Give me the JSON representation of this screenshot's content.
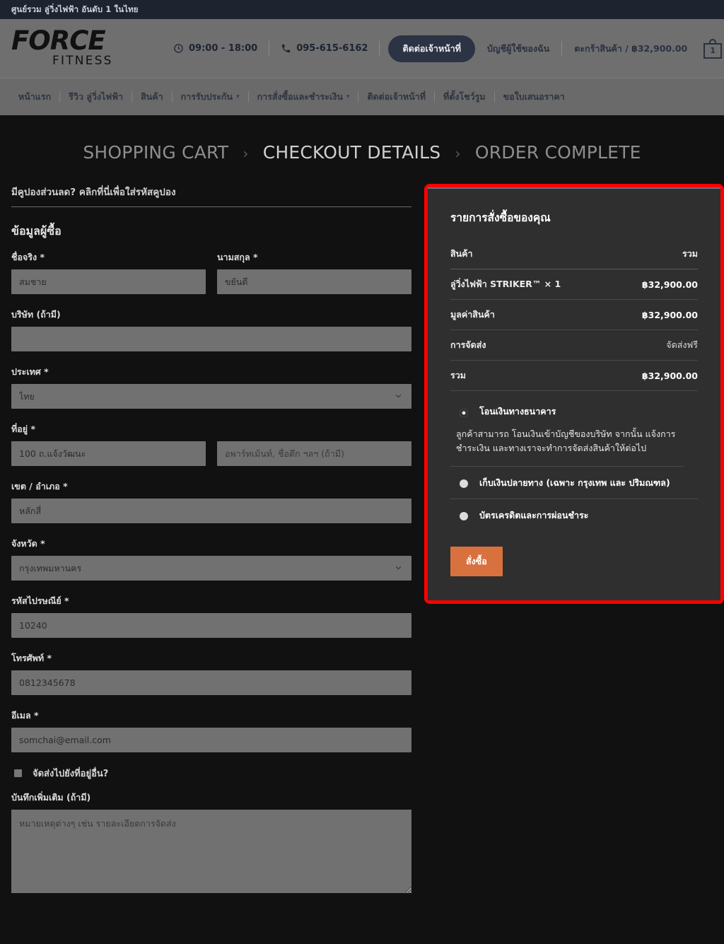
{
  "topbar": {
    "tagline": "ศูนย์รวม ลู่วิ่งไฟฟ้า อันดับ 1 ในไทย"
  },
  "header": {
    "logo_mark": "FORCE",
    "logo_sub": "FITNESS",
    "hours": "09:00 - 18:00",
    "phone": "095-615-6162",
    "contact_button": "ติดต่อเจ้าหน้าที่",
    "account_link": "บัญชีผู้ใช้ของฉัน",
    "cart_link": "ตะกร้าสินค้า / ฿32,900.00",
    "cart_count": "1"
  },
  "nav": {
    "items": [
      {
        "label": "หน้าแรก",
        "has_caret": false
      },
      {
        "label": "รีวิว ลู่วิ่งไฟฟ้า",
        "has_caret": false
      },
      {
        "label": "สินค้า",
        "has_caret": false
      },
      {
        "label": "การรับประกัน",
        "has_caret": true
      },
      {
        "label": "การสั่งซื้อและชำระเงิน",
        "has_caret": true
      },
      {
        "label": "ติดต่อเจ้าหน้าที่",
        "has_caret": false
      },
      {
        "label": "ที่ตั้งโชว์รูม",
        "has_caret": false
      },
      {
        "label": "ขอใบเสนอราคา",
        "has_caret": false
      }
    ]
  },
  "steps": {
    "cart": "SHOPPING CART",
    "details": "CHECKOUT DETAILS",
    "complete": "ORDER COMPLETE",
    "separator": "›"
  },
  "checkout": {
    "coupon_text": "มีคูปองส่วนลด? คลิกที่นี่เพื่อใส่รหัสคูปอง",
    "billing_title": "ข้อมูลผู้ซื้อ",
    "first_name": {
      "label": "ชื่อจริง",
      "required": "*",
      "value": "สมชาย"
    },
    "last_name": {
      "label": "นามสกุล",
      "required": "*",
      "value": "ขยันดี"
    },
    "company": {
      "label": "บริษัท (ถ้ามี)",
      "value": ""
    },
    "country": {
      "label": "ประเทศ",
      "required": "*",
      "value": "ไทย"
    },
    "address": {
      "label": "ที่อยู่",
      "required": "*",
      "value": "100 ถ.แจ้งวัฒนะ"
    },
    "address2": {
      "placeholder": "อพาร์ทเม้นท์, ชื่อตึก ฯลฯ (ถ้ามี)",
      "value": ""
    },
    "district": {
      "label": "เขต / อำเภอ",
      "required": "*",
      "value": "หลักสี่"
    },
    "province": {
      "label": "จังหวัด",
      "required": "*",
      "value": "กรุงเทพมหานคร"
    },
    "postcode": {
      "label": "รหัสไปรษณีย์",
      "required": "*",
      "value": "10240"
    },
    "phone": {
      "label": "โทรศัพท์",
      "required": "*",
      "value": "0812345678"
    },
    "email": {
      "label": "อีเมล",
      "required": "*",
      "value": "somchai@email.com"
    },
    "ship_other": {
      "label": "จัดส่งไปยังที่อยู่อื่น?",
      "checked": false
    },
    "notes": {
      "label": "บันทึกเพิ่มเติม (ถ้ามี)",
      "placeholder": "หมายเหตุต่างๆ เช่น รายละเอียดการจัดส่ง",
      "value": ""
    }
  },
  "order_summary": {
    "title": "รายการสั่งซื้อของคุณ",
    "col_product": "สินค้า",
    "col_total": "รวม",
    "lines": [
      {
        "name": "ลู่วิ่งไฟฟ้า STRIKER™ × 1",
        "value": "฿32,900.00",
        "soft": false
      },
      {
        "name": "มูลค่าสินค้า",
        "value": "฿32,900.00",
        "soft": false
      },
      {
        "name": "การจัดส่ง",
        "value": "จัดส่งฟรี",
        "soft": true
      },
      {
        "name": "รวม",
        "value": "฿32,900.00",
        "soft": false
      }
    ],
    "payment_methods": [
      {
        "label": "โอนเงินทางธนาคาร",
        "selected": true,
        "description": "ลูกค้าสามารถ โอนเงินเข้าบัญชีของบริษัท จากนั้น แจ้งการชำระเงิน และทางเราจะทำการจัดส่งสินค้าให้ต่อไป"
      },
      {
        "label": "เก็บเงินปลายทาง (เฉพาะ กรุงเทพ และ ปริมณฑล)",
        "selected": false,
        "description": ""
      },
      {
        "label": "บัตรเครดิตและการผ่อนชำระ",
        "selected": false,
        "description": ""
      }
    ],
    "place_order_button": "สั่งซื้อ"
  },
  "colors": {
    "highlight_border": "#ff0000",
    "order_button": "#d9713f",
    "topbar_bg": "#1d2430",
    "header_bg": "#6f6f6f",
    "page_bg": "#111111",
    "panel_bg": "#2f2f2f"
  }
}
